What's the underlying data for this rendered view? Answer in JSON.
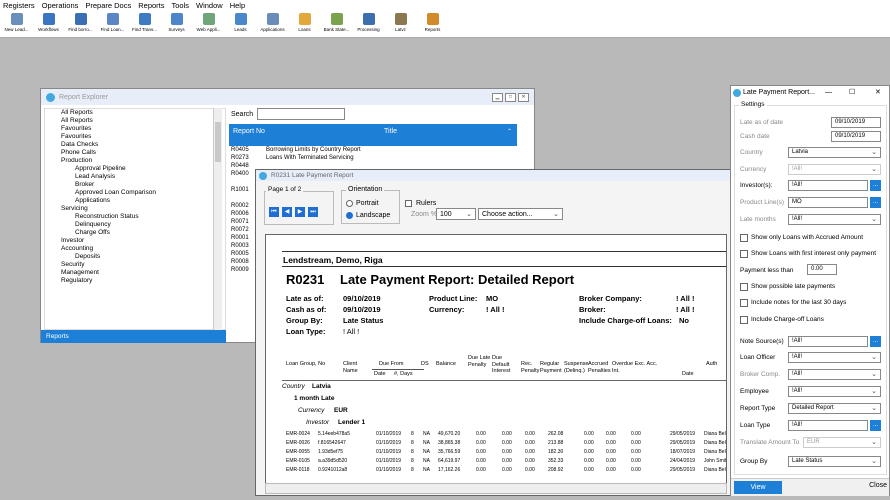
{
  "menu": [
    "Registers",
    "Operations",
    "Prepare Docs",
    "Reports",
    "Tools",
    "Window",
    "Help"
  ],
  "toolbar": [
    "New Lead...",
    "Workflows",
    "Find borro...",
    "Find Loan...",
    "Find Trans...",
    "Surveys",
    "Web Appli...",
    "Leads",
    "Applications",
    "Loans",
    "Bank State...",
    "Processing",
    "Latvz",
    "Reports"
  ],
  "toolbar_colors": [
    "#6a8fbd",
    "#3b74c2",
    "#3a6fb5",
    "#5a86c6",
    "#3e7bc4",
    "#4e84c8",
    "#6fa57a",
    "#4a89c9",
    "#6b8cb8",
    "#e2a83b",
    "#7ba24f",
    "#3d6fb0",
    "#8a7850",
    "#d28a2b"
  ],
  "explorer": {
    "title": "Report Explorer",
    "tree": [
      "All Reports",
      "All Reports",
      "Favourites",
      "Favourites",
      "Data Checks",
      "Phone Calls",
      "Production",
      "Approval Pipeline",
      "Lead Analysis",
      "Broker",
      "Approved Loan Comparison",
      "Applications",
      "Servicing",
      "Reconstruction Status",
      "Delinquency",
      "Charge Offs",
      "Investor",
      "Accounting",
      "Deposits",
      "Security",
      "Management",
      "Regulatory"
    ],
    "tree_indent": [
      0,
      0,
      0,
      0,
      0,
      0,
      0,
      1,
      1,
      1,
      1,
      1,
      0,
      1,
      1,
      1,
      0,
      0,
      1,
      0,
      0,
      0
    ],
    "footer_tab": "Reports",
    "search_label": "Search",
    "col_report_no": "Report No",
    "col_title": "Title",
    "rows": [
      [
        "R0405",
        "Borrowing Limits by Country Report"
      ],
      [
        "R0273",
        "Loans With Terminated Servicing"
      ],
      [
        "R0448",
        ""
      ],
      [
        "R0400",
        ""
      ],
      [
        "",
        ""
      ],
      [
        "R1001",
        ""
      ],
      [
        "",
        ""
      ],
      [
        "R0002",
        ""
      ],
      [
        "R0006",
        ""
      ],
      [
        "R0071",
        ""
      ],
      [
        "R0072",
        ""
      ],
      [
        "R0001",
        ""
      ],
      [
        "R0003",
        ""
      ],
      [
        "R0005",
        ""
      ],
      [
        "R0008",
        ""
      ],
      [
        "R0009",
        ""
      ]
    ]
  },
  "preview": {
    "title": "R0231 Late Payment Report",
    "page_label": "Page 1 of 2",
    "orientation_label": "Orientation",
    "opt_portrait": "Portrait",
    "opt_landscape": "Landscape",
    "rulers_label": "Rulers",
    "zoom_label": "Zoom %",
    "zoom_value": "100",
    "action_placeholder": "Choose action...",
    "company": "Lendstream, Demo, Riga",
    "report_code": "R0231",
    "report_title": "Late Payment Report: Detailed Report",
    "hdr_labels": [
      "Late as of:",
      "Cash as of:",
      "Group By:",
      "Loan Type:"
    ],
    "hdr_values": [
      "09/10/2019",
      "09/10/2019",
      "Late Status",
      "! All !"
    ],
    "mid_labels": [
      "Product Line:",
      "Currency:"
    ],
    "mid_values": [
      "MO",
      "! All !"
    ],
    "right_labels": [
      "Broker Company:",
      "Broker:",
      "Include Charge-off Loans:"
    ],
    "right_values": [
      "! All !",
      "! All !",
      "No"
    ],
    "columns": [
      "Loan Group, No",
      "Client Name",
      "Due From Date",
      "#, Days",
      "DS",
      "Balance",
      "Due Late Penalty",
      "Due Default Interest",
      "Rec. Penalty",
      "Regular Payment",
      "Suspense (Delinq.)",
      "Accrued Penalties",
      "Overdue Exc. Acc. Int.",
      "Date",
      "Auth"
    ],
    "due_from": "Due From",
    "col_date": "Date",
    "col_days": "#, Days",
    "group_country_label": "Country",
    "group_country": "Latvia",
    "group_late": "1 month Late",
    "group_currency_label": "Currency",
    "group_currency": "EUR",
    "group_investor_label": "Investor",
    "group_investor": "Lender 1",
    "rows": [
      [
        "EMR-0024",
        "5.14eeb478a5",
        "01/10/2019",
        "8",
        "NA",
        "49,670.20",
        "0.00",
        "0.00",
        "0.00",
        "262.08",
        "0.00",
        "0.00",
        "0.00",
        "29/05/2019",
        "Diana Belk"
      ],
      [
        "EMR-0026",
        "f.816542647",
        "01/10/2019",
        "8",
        "NA",
        "38,865.38",
        "0.00",
        "0.00",
        "0.00",
        "213.88",
        "0.00",
        "0.00",
        "0.00",
        "29/05/2019",
        "Diana Belk"
      ],
      [
        "EMR-0055",
        "1.93d5ef75",
        "01/10/2019",
        "8",
        "NA",
        "35,766.59",
        "0.00",
        "0.00",
        "0.00",
        "182.30",
        "0.00",
        "0.00",
        "0.00",
        "18/07/2019",
        "Diana Belk"
      ],
      [
        "EMR-0105",
        "a.a39d5d520",
        "01/10/2019",
        "8",
        "NA",
        "64,619.97",
        "0.00",
        "0.00",
        "0.00",
        "352.33",
        "0.00",
        "0.00",
        "0.00",
        "24/04/2019",
        "John Smith"
      ],
      [
        "EMR-0118",
        "0.9241012a8",
        "01/10/2019",
        "8",
        "NA",
        "17,162.26",
        "0.00",
        "0.00",
        "0.00",
        "208.92",
        "0.00",
        "0.00",
        "0.00",
        "29/05/2019",
        "Diana Belk"
      ]
    ]
  },
  "settings": {
    "title": "Late Payment Report...",
    "group_label": "Settings",
    "late_as_of_label": "Late as of date",
    "late_as_of": "09/10/2019",
    "cash_date_label": "Cash date",
    "cash_date": "09/10/2019",
    "country_label": "Country",
    "country": "Latvia",
    "currency_label": "Currency",
    "currency": "!All!",
    "investor_label": "Investor(s):",
    "investor": "!All!",
    "product_label": "Product Line(s)",
    "product": "MO",
    "late_months_label": "Late months",
    "late_months": "!All!",
    "chk_accrued": "Show only Loans with Accrued Amount",
    "chk_first": "Show Loans with first interest only payment",
    "payment_less_label": "Payment less than",
    "payment_less": "0.00",
    "chk_possible": "Show possible late payments",
    "chk_notes": "Include notes for the last 30 days",
    "chk_chargeoff": "Include Charge-off Loans",
    "note_source_label": "Note Source(s)",
    "note_source": "!All!",
    "loan_officer_label": "Loan Officer",
    "loan_officer": "!All!",
    "broker_comp_label": "Broker Comp.",
    "broker_comp": "!All!",
    "employee_label": "Employee",
    "employee": "!All!",
    "report_type_label": "Report Type",
    "report_type": "Detailed Report",
    "loan_type_label": "Loan Type",
    "loan_type": "!All!",
    "translate_label": "Translate Amount To",
    "translate": "EUR",
    "group_by_label": "Group By",
    "group_by": "Late Status",
    "view_label": "View",
    "close_label": "Close"
  }
}
